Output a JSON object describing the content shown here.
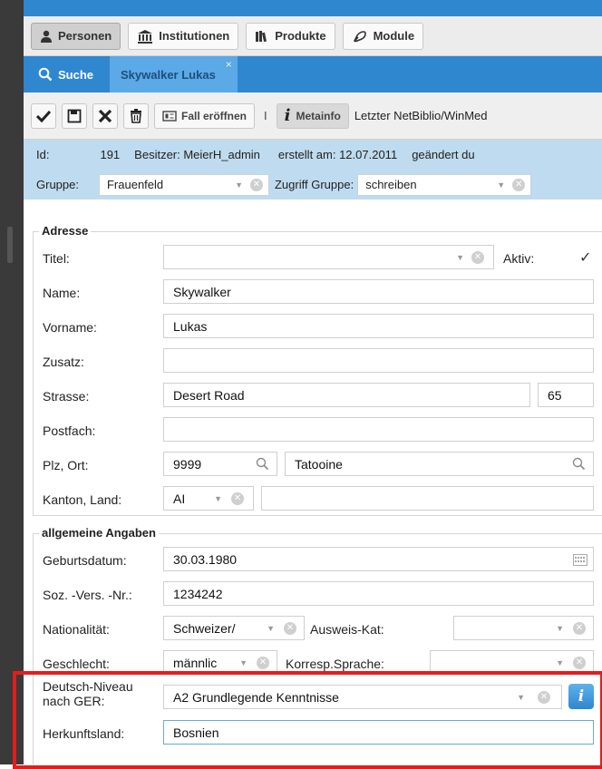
{
  "nav": {
    "personen": "Personen",
    "institutionen": "Institutionen",
    "produkte": "Produkte",
    "module": "Module"
  },
  "tabs": {
    "search": "Suche",
    "person": "Skywalker Lukas",
    "close": "×"
  },
  "toolbar": {
    "fall": "Fall eröffnen",
    "separator": "I",
    "metainfo": "Metainfo",
    "last_info": "Letzter NetBiblio/WinMed"
  },
  "info": {
    "id_label": "Id:",
    "id_value": "191",
    "besitzer": "Besitzer: MeierH_admin",
    "erstellt": "erstellt am: 12.07.2011",
    "geaendert": "geändert du",
    "gruppe_label": "Gruppe:",
    "gruppe_value": "Frauenfeld",
    "zugriff_label": "Zugriff Gruppe:",
    "zugriff_value": "schreiben"
  },
  "adresse": {
    "legend": "Adresse",
    "titel_label": "Titel:",
    "aktiv_label": "Aktiv:",
    "name_label": "Name:",
    "name_value": "Skywalker",
    "vorname_label": "Vorname:",
    "vorname_value": "Lukas",
    "zusatz_label": "Zusatz:",
    "strasse_label": "Strasse:",
    "strasse_value": "Desert Road",
    "hausnr_value": "65",
    "postfach_label": "Postfach:",
    "plz_label": "Plz, Ort:",
    "plz_value": "9999",
    "ort_value": "Tatooine",
    "kanton_label": "Kanton, Land:",
    "kanton_value": "AI"
  },
  "allgemein": {
    "legend": "allgemeine Angaben",
    "geburt_label": "Geburtsdatum:",
    "geburt_value": "30.03.1980",
    "ahv_label": "Soz. -Vers. -Nr.:",
    "ahv_value": "1234242",
    "nation_label": "Nationalität:",
    "nation_value": "Schweizer/",
    "ausweis_label": "Ausweis-Kat:",
    "geschlecht_label": "Geschlecht:",
    "geschlecht_value": "männlic",
    "sprache_label": "Korresp.Sprache:",
    "deutsch_label_1": "Deutsch-Niveau",
    "deutsch_label_2": "nach GER:",
    "deutsch_value": "A2 Grundlegende Kenntnisse",
    "herkunft_label": "Herkunftsland:",
    "herkunft_value": "Bosnien"
  },
  "colors": {
    "accent": "#2f87d0",
    "info_panel": "#bfdbef",
    "highlight": "#e41c1c"
  }
}
